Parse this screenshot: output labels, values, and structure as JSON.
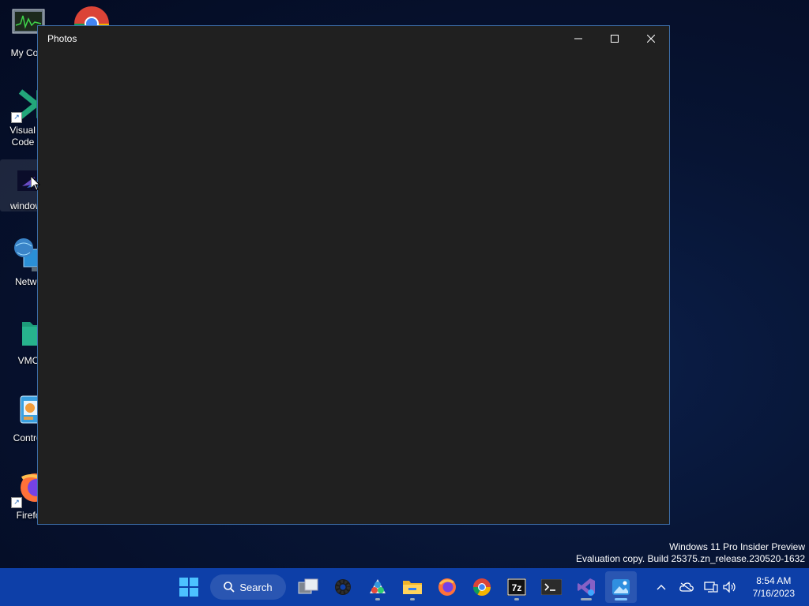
{
  "desktop": {
    "icons": [
      {
        "label": "My Com"
      },
      {
        "label": "Visual St\nCode - I"
      },
      {
        "label": "windows"
      },
      {
        "label": "Netwo"
      },
      {
        "label": "VMC"
      },
      {
        "label": "Control"
      },
      {
        "label": "Firefo"
      }
    ]
  },
  "window": {
    "title": "Photos",
    "minimize_icon": "minimize-icon",
    "maximize_icon": "maximize-icon",
    "close_icon": "close-icon"
  },
  "watermark": {
    "line1": "Windows 11 Pro Insider Preview",
    "line2": "Evaluation copy. Build 25375.zn_release.230520-1632"
  },
  "taskbar": {
    "search_label": "Search",
    "pinned": [
      "start-icon",
      "search-icon",
      "task-view-icon",
      "settings-icon",
      "inkscape-icon",
      "file-explorer-icon",
      "firefox-icon",
      "chrome-icon",
      "7zip-icon",
      "terminal-icon",
      "visual-studio-icon",
      "photos-icon"
    ],
    "tray": {
      "chevron_icon": "chevron-up-icon",
      "onedrive_icon": "cloud-icon",
      "network_icon": "network-icon",
      "volume_icon": "volume-icon"
    },
    "clock": {
      "time": "8:54 AM",
      "date": "7/16/2023"
    }
  },
  "colors": {
    "taskbar": "#0d3fa8",
    "window_bg": "#202020",
    "accent": "#3d6ea8"
  }
}
